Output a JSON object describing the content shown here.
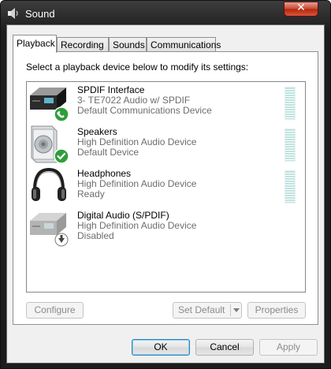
{
  "window": {
    "title": "Sound",
    "close_label": "✕"
  },
  "tabs": [
    {
      "label": "Playback",
      "active": true
    },
    {
      "label": "Recording",
      "active": false
    },
    {
      "label": "Sounds",
      "active": false
    },
    {
      "label": "Communications",
      "active": false
    }
  ],
  "playback": {
    "instruction": "Select a playback device below to modify its settings:",
    "devices": [
      {
        "name": "SPDIF Interface",
        "line1": "3- TE7022 Audio w/ SPDIF",
        "line2": "Default Communications Device",
        "icon": "spdif-receiver-icon",
        "badge": "phone-badge-icon"
      },
      {
        "name": "Speakers",
        "line1": "High Definition Audio Device",
        "line2": "Default Device",
        "icon": "speaker-icon",
        "badge": "checkmark-badge-icon"
      },
      {
        "name": "Headphones",
        "line1": "High Definition Audio Device",
        "line2": "Ready",
        "icon": "headphones-icon",
        "badge": ""
      },
      {
        "name": "Digital Audio (S/PDIF)",
        "line1": "High Definition Audio Device",
        "line2": "Disabled",
        "icon": "digital-audio-receiver-icon",
        "badge": "disabled-arrow-badge-icon"
      }
    ],
    "configure_label": "Configure",
    "set_default_label": "Set Default",
    "properties_label": "Properties"
  },
  "footer": {
    "ok_label": "OK",
    "cancel_label": "Cancel",
    "apply_label": "Apply"
  },
  "colors": {
    "badge_green": "#2f9e3a",
    "meter": "#bfe3df",
    "secondary_text": "#6d6d6d",
    "disabled_text": "#8b8b8b"
  }
}
